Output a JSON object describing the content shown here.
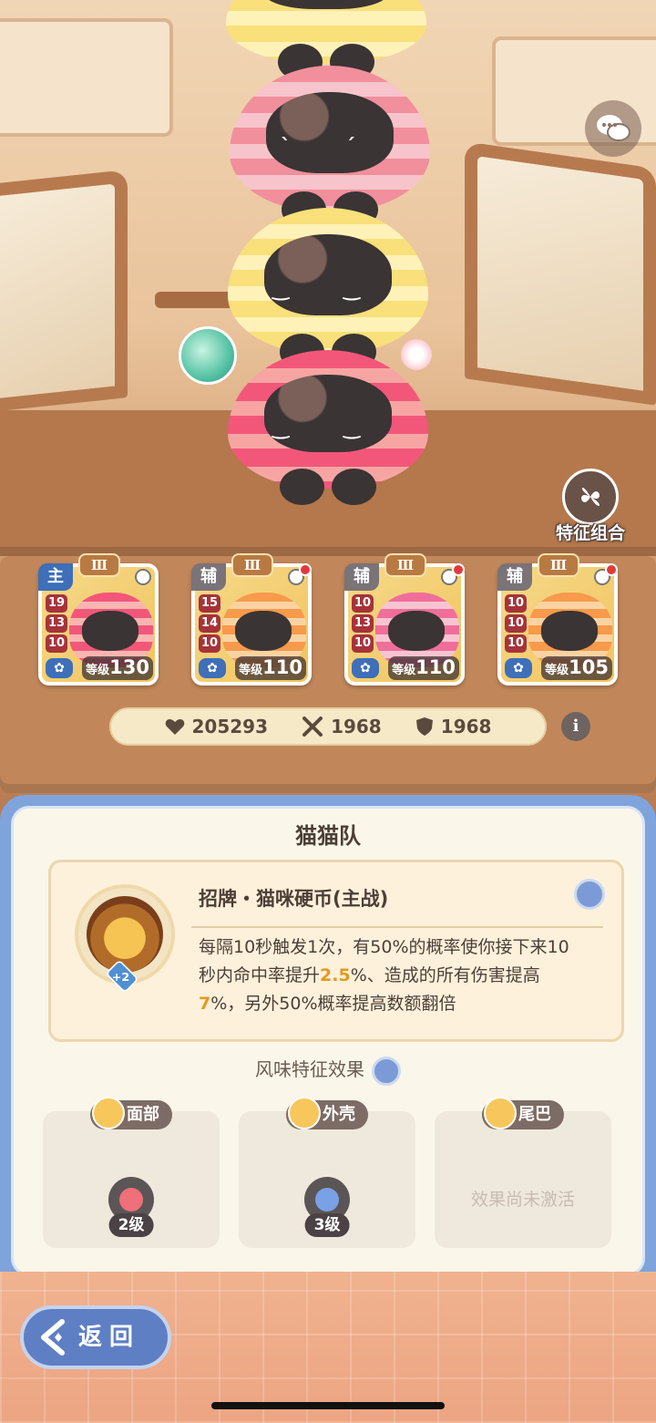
{
  "chat_icon": "chat-bubbles-icon",
  "traits": {
    "label": "特征组合",
    "icon": "four-petal-icon"
  },
  "cards": [
    {
      "role": "主",
      "rank": "Ⅲ",
      "stats": [
        "19",
        "13",
        "10"
      ],
      "level_prefix": "等级",
      "level": "130",
      "has_dot": false
    },
    {
      "role": "辅",
      "rank": "Ⅲ",
      "stats": [
        "15",
        "14",
        "10"
      ],
      "level_prefix": "等级",
      "level": "110",
      "has_dot": true
    },
    {
      "role": "辅",
      "rank": "Ⅲ",
      "stats": [
        "10",
        "13",
        "10"
      ],
      "level_prefix": "等级",
      "level": "110",
      "has_dot": true
    },
    {
      "role": "辅",
      "rank": "Ⅲ",
      "stats": [
        "10",
        "10",
        "10"
      ],
      "level_prefix": "等级",
      "level": "105",
      "has_dot": true
    }
  ],
  "stats": {
    "hp": "205293",
    "attack": "1968",
    "defense": "1968"
  },
  "panel": {
    "title": "猫猫队",
    "skill": {
      "name": "招牌・猫咪硬币(主战)",
      "plus": "+2",
      "desc_parts": [
        {
          "t": "每隔10秒触发1次，有50%的概率使你接下来10秒内命中率提升",
          "hl": false
        },
        {
          "t": "2.5",
          "hl": true
        },
        {
          "t": "%、造成的所有伤害提高",
          "hl": false
        },
        {
          "t": "7",
          "hl": true
        },
        {
          "t": "%，另外50%概率提高数额翻倍",
          "hl": false
        }
      ]
    },
    "flavor_title": "风味特征效果",
    "slots": [
      {
        "tag": "面部",
        "level": "2级",
        "empty": ""
      },
      {
        "tag": "外壳",
        "level": "3级",
        "empty": ""
      },
      {
        "tag": "尾巴",
        "level": "",
        "empty": "效果尚未激活"
      }
    ]
  },
  "back": {
    "label": "返回"
  },
  "colors": {
    "accent_blue": "#7fa3db",
    "highlight": "#e39a1e",
    "hp_red": "#a6333a"
  }
}
